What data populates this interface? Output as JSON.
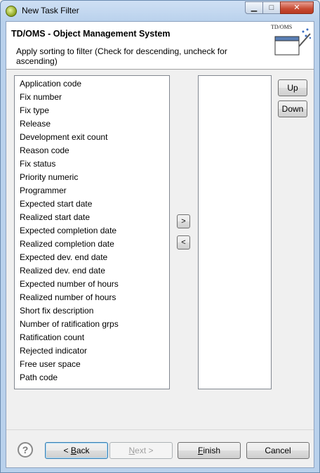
{
  "window": {
    "title": "New Task Filter",
    "controls": {
      "minimize": "▁",
      "maximize": "□",
      "close": "✕"
    }
  },
  "header": {
    "title": "TD/OMS - Object Management System",
    "description": "Apply sorting to filter (Check for descending, uncheck for ascending)",
    "graphic_label": "TD/OMS"
  },
  "available_list": {
    "items": [
      "Application code",
      "Fix number",
      "Fix type",
      "Release",
      "Development exit count",
      "Reason code",
      "Fix status",
      "Priority numeric",
      "Programmer",
      "Expected start date",
      "Realized start date",
      "Expected completion date",
      "Realized completion date",
      "Expected dev. end date",
      "Realized dev. end date",
      "Expected number of hours",
      "Realized number of hours",
      "Short fix description",
      "Number of ratification grps",
      "Ratification count",
      "Rejected indicator",
      "Free user space",
      "Path code"
    ]
  },
  "selected_list": {
    "items": []
  },
  "move_buttons": {
    "add": ">",
    "remove": "<"
  },
  "order_buttons": {
    "up": "Up",
    "down": "Down"
  },
  "footer": {
    "help": "?",
    "back_prefix": "< ",
    "back_mnemonic": "B",
    "back_rest": "ack",
    "next_mnemonic": "N",
    "next_rest": "ext >",
    "finish_mnemonic": "F",
    "finish_rest": "inish",
    "cancel": "Cancel"
  }
}
